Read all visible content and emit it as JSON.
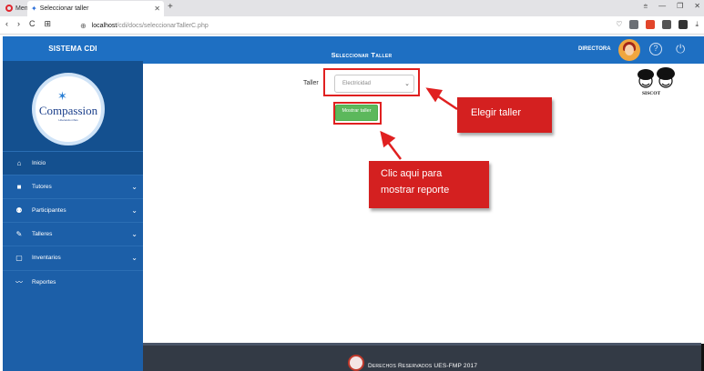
{
  "browser": {
    "menu_label": "Menú",
    "tab_title": "Seleccionar taller",
    "tab_close": "✕",
    "new_tab": "+",
    "url_host": "localhost",
    "url_path": "/cdi/docs/seleccionarTallerC.php",
    "nav_back": "‹",
    "nav_forward": "›",
    "nav_reload": "C",
    "nav_grid": "⊞"
  },
  "sidebar": {
    "brand": "SISTEMA CDI",
    "logo_text": "Compassion",
    "logo_sub": "Liberando niños",
    "items": [
      {
        "label": "Inicio",
        "icon": "home-icon",
        "has_children": false
      },
      {
        "label": "Tutores",
        "icon": "briefcase-icon",
        "has_children": true
      },
      {
        "label": "Participantes",
        "icon": "users-icon",
        "has_children": true
      },
      {
        "label": "Talleres",
        "icon": "wrench-icon",
        "has_children": true
      },
      {
        "label": "Inventarios",
        "icon": "clipboard-icon",
        "has_children": true
      },
      {
        "label": "Reportes",
        "icon": "chart-line-icon",
        "has_children": false
      }
    ]
  },
  "header": {
    "title": "Seleccionar Taller",
    "user_role": "DIRECTORA"
  },
  "form": {
    "taller_label": "Taller",
    "taller_value": "Electricidad",
    "submit_label": "Mostrar taller"
  },
  "annotations": {
    "elegir": "Elegir taller",
    "clic_line1": "Clic aqui para",
    "clic_line2": "mostrar reporte"
  },
  "siscot_label": "SISCOT",
  "footer": {
    "text": "Derechos Reservados UES-FMP 2017"
  },
  "colors": {
    "header_blue": "#1e6fc2",
    "sidebar_blue": "#1c5fa8",
    "success_green": "#5cb85c",
    "annotation_red": "#d42020",
    "footer_dark": "#333a45"
  }
}
